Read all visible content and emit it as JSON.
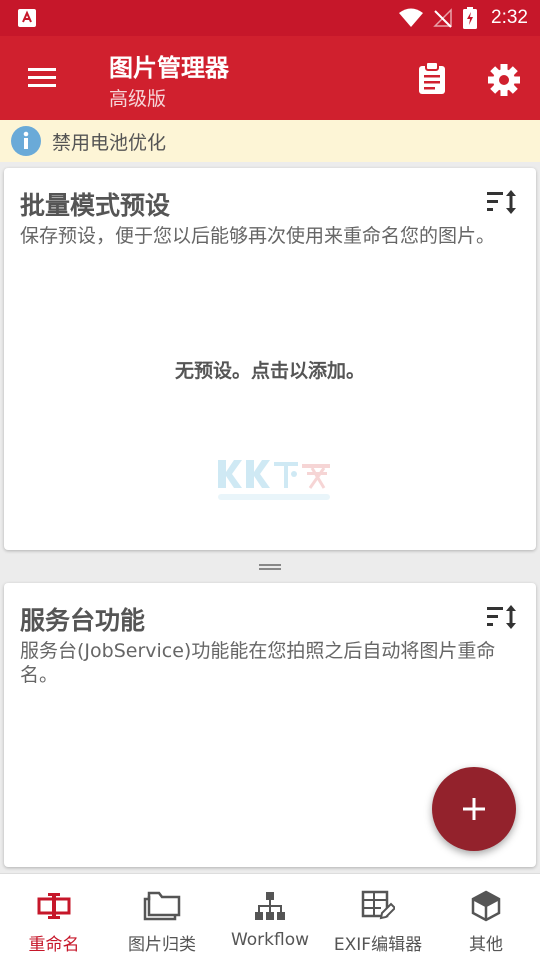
{
  "status_bar": {
    "time": "2:32"
  },
  "app_bar": {
    "title": "图片管理器",
    "subtitle": "高级版"
  },
  "banner": {
    "text": "禁用电池优化"
  },
  "presets_card": {
    "title": "批量模式预设",
    "description": "保存预设，便于您以后能够再次使用来重命名您的图片。",
    "empty_text": "无预设。点击以添加。"
  },
  "service_card": {
    "title": "服务台功能",
    "description": "服务台(JobService)功能能在您拍照之后自动将图片重命名。"
  },
  "bottom_nav": {
    "items": [
      {
        "label": "重命名",
        "icon": "rename-icon",
        "active": true
      },
      {
        "label": "图片归类",
        "icon": "folder-icon",
        "active": false
      },
      {
        "label": "Workflow",
        "icon": "hierarchy-icon",
        "active": false
      },
      {
        "label": "EXIF编辑器",
        "icon": "table-edit-icon",
        "active": false
      },
      {
        "label": "其他",
        "icon": "cube-icon",
        "active": false
      }
    ]
  },
  "colors": {
    "primary": "#d0202e",
    "status_bar": "#c6172a",
    "fab": "#93222c",
    "banner_bg": "#fdf5d6",
    "info_blue": "#6aaad8"
  }
}
